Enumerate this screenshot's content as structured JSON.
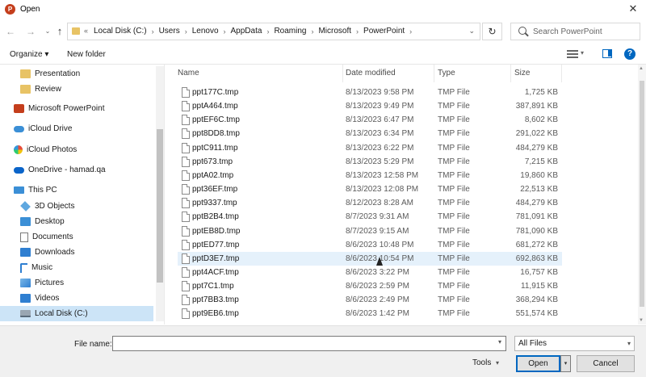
{
  "window": {
    "title": "Open",
    "app_icon": "powerpoint-icon",
    "close_glyph": "✕"
  },
  "nav": {
    "back_glyph": "←",
    "forward_glyph": "→",
    "recent_glyph": "⌄",
    "up_glyph": "↑",
    "breadcrumb_prefix": "«",
    "breadcrumbs": [
      "Local Disk (C:)",
      "Users",
      "Lenovo",
      "AppData",
      "Roaming",
      "Microsoft",
      "PowerPoint"
    ],
    "crumb_separator": "›",
    "dropdown_glyph": "⌄",
    "refresh_glyph": "↻",
    "search_placeholder": "Search PowerPoint"
  },
  "toolbar": {
    "organize_label": "Organize ▾",
    "new_folder_label": "New folder",
    "view_dropdown_glyph": "▾",
    "help_glyph": "?"
  },
  "sidebar": {
    "items": [
      {
        "label": "Presentation",
        "icon": "folder-icon"
      },
      {
        "label": "Review",
        "icon": "folder-icon"
      },
      {
        "label": "Microsoft PowerPoint",
        "icon": "powerpoint-icon"
      },
      {
        "label": "iCloud Drive",
        "icon": "icloud-drive-icon"
      },
      {
        "label": "iCloud Photos",
        "icon": "icloud-photos-icon"
      },
      {
        "label": "OneDrive - hamad.qa",
        "icon": "onedrive-icon"
      },
      {
        "label": "This PC",
        "icon": "this-pc-icon"
      },
      {
        "label": "3D Objects",
        "icon": "3d-objects-icon"
      },
      {
        "label": "Desktop",
        "icon": "desktop-icon"
      },
      {
        "label": "Documents",
        "icon": "documents-icon"
      },
      {
        "label": "Downloads",
        "icon": "downloads-icon"
      },
      {
        "label": "Music",
        "icon": "music-icon"
      },
      {
        "label": "Pictures",
        "icon": "pictures-icon"
      },
      {
        "label": "Videos",
        "icon": "videos-icon"
      },
      {
        "label": "Local Disk (C:)",
        "icon": "local-disk-icon"
      }
    ]
  },
  "files": {
    "columns": {
      "name": "Name",
      "date": "Date modified",
      "type": "Type",
      "size": "Size"
    },
    "sort_glyph": "⌃",
    "rows": [
      {
        "name": "ppt177C.tmp",
        "date": "8/13/2023 9:58 PM",
        "type": "TMP File",
        "size": "1,725 KB"
      },
      {
        "name": "pptA464.tmp",
        "date": "8/13/2023 9:49 PM",
        "type": "TMP File",
        "size": "387,891 KB"
      },
      {
        "name": "pptEF6C.tmp",
        "date": "8/13/2023 6:47 PM",
        "type": "TMP File",
        "size": "8,602 KB"
      },
      {
        "name": "ppt8DD8.tmp",
        "date": "8/13/2023 6:34 PM",
        "type": "TMP File",
        "size": "291,022 KB"
      },
      {
        "name": "pptC911.tmp",
        "date": "8/13/2023 6:22 PM",
        "type": "TMP File",
        "size": "484,279 KB"
      },
      {
        "name": "ppt673.tmp",
        "date": "8/13/2023 5:29 PM",
        "type": "TMP File",
        "size": "7,215 KB"
      },
      {
        "name": "pptA02.tmp",
        "date": "8/13/2023 12:58 PM",
        "type": "TMP File",
        "size": "19,860 KB"
      },
      {
        "name": "ppt36EF.tmp",
        "date": "8/13/2023 12:08 PM",
        "type": "TMP File",
        "size": "22,513 KB"
      },
      {
        "name": "ppt9337.tmp",
        "date": "8/12/2023 8:28 AM",
        "type": "TMP File",
        "size": "484,279 KB"
      },
      {
        "name": "pptB2B4.tmp",
        "date": "8/7/2023 9:31 AM",
        "type": "TMP File",
        "size": "781,091 KB"
      },
      {
        "name": "pptEB8D.tmp",
        "date": "8/7/2023 9:15 AM",
        "type": "TMP File",
        "size": "781,090 KB"
      },
      {
        "name": "pptED77.tmp",
        "date": "8/6/2023 10:48 PM",
        "type": "TMP File",
        "size": "681,272 KB"
      },
      {
        "name": "pptD3E7.tmp",
        "date": "8/6/2023 10:54 PM",
        "type": "TMP File",
        "size": "692,863 KB"
      },
      {
        "name": "ppt4ACF.tmp",
        "date": "8/6/2023 3:22 PM",
        "type": "TMP File",
        "size": "16,757 KB"
      },
      {
        "name": "ppt7C1.tmp",
        "date": "8/6/2023 2:59 PM",
        "type": "TMP File",
        "size": "11,915 KB"
      },
      {
        "name": "ppt7BB3.tmp",
        "date": "8/6/2023 2:49 PM",
        "type": "TMP File",
        "size": "368,294 KB"
      },
      {
        "name": "ppt9EB6.tmp",
        "date": "8/6/2023 1:42 PM",
        "type": "TMP File",
        "size": "551,574 KB"
      }
    ]
  },
  "footer": {
    "file_name_label": "File name:",
    "file_name_value": "",
    "file_name_dropdown_glyph": "▾",
    "file_type_value": "All Files",
    "file_type_dropdown_glyph": "▾",
    "tools_label": "Tools",
    "tools_caret": "▾",
    "open_label": "Open",
    "open_split_glyph": "▾",
    "cancel_label": "Cancel"
  },
  "colors": {
    "accent": "#0067c0",
    "selection": "#cce4f7",
    "hover": "#e5f1fb",
    "folder": "#e8c365",
    "powerpoint": "#c43e1c"
  }
}
